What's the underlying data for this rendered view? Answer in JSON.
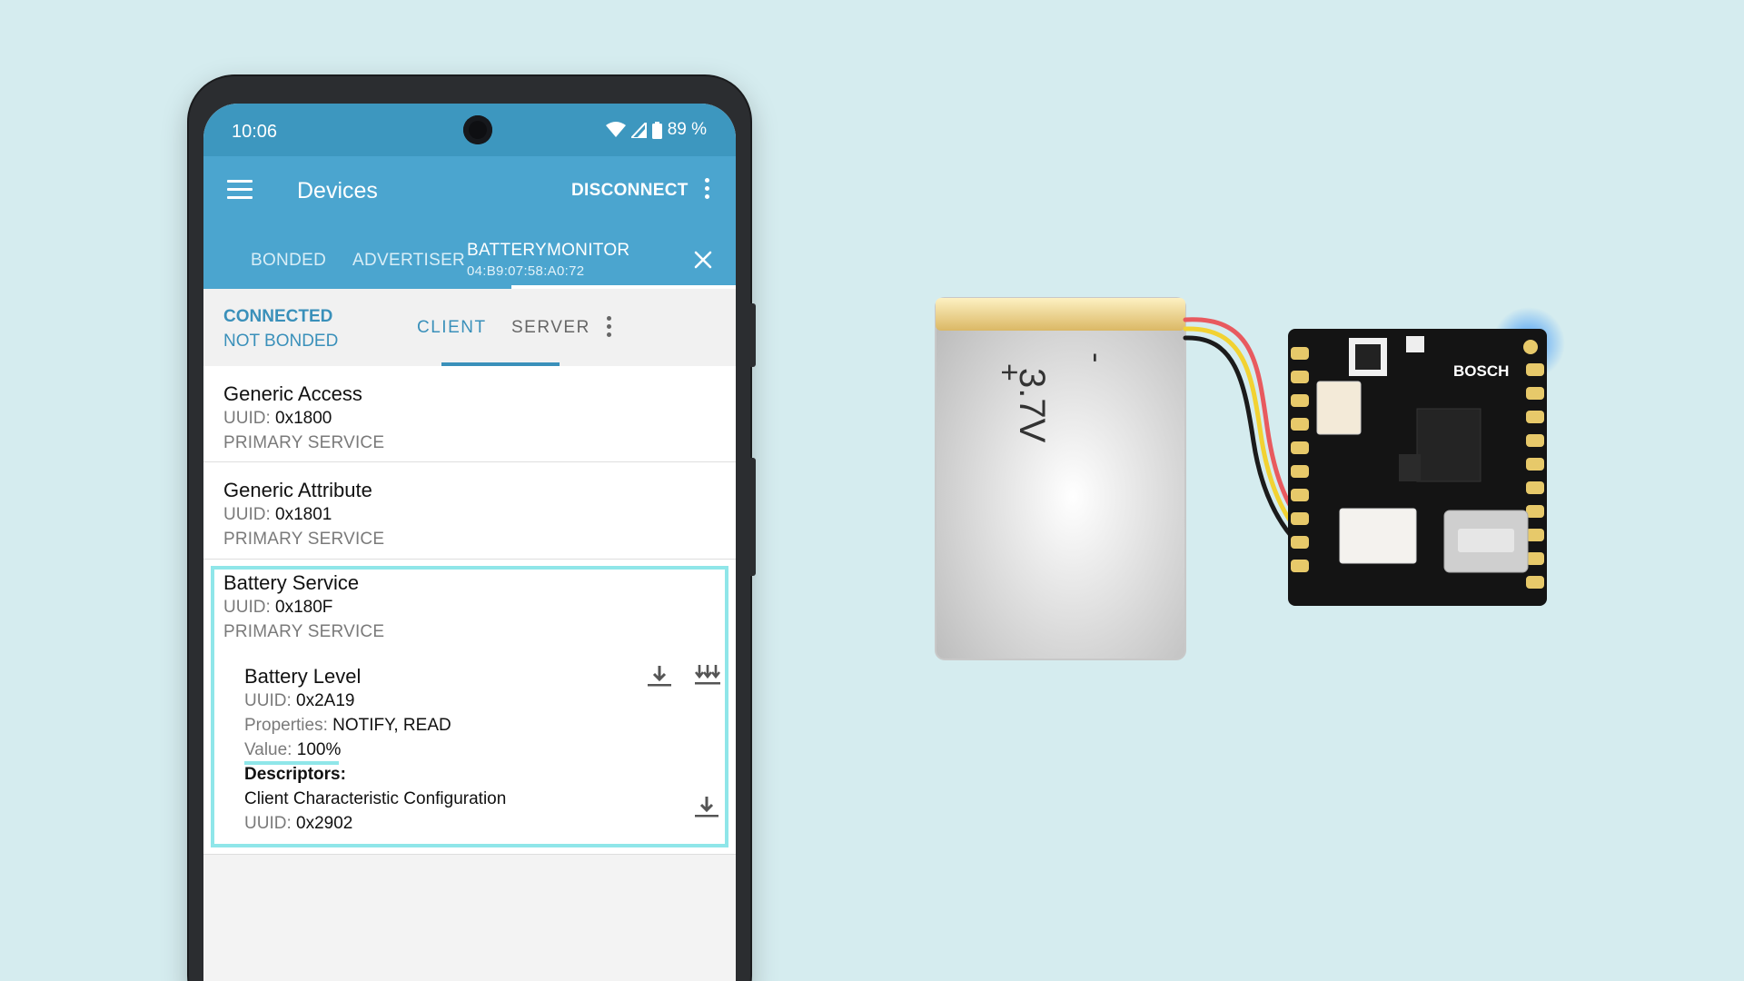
{
  "status_bar": {
    "time": "10:06",
    "battery_percent": "89 %"
  },
  "app_bar": {
    "title": "Devices",
    "disconnect_label": "DISCONNECT"
  },
  "device_tabs": [
    {
      "label": "BONDED"
    },
    {
      "label": "ADVERTISER"
    },
    {
      "label": "BATTERYMONITOR",
      "address": "04:B9:07:58:A0:72",
      "active": true
    }
  ],
  "connection": {
    "state": "CONNECTED",
    "bond": "NOT BONDED"
  },
  "subtabs": [
    {
      "label": "CLIENT",
      "active": true
    },
    {
      "label": "SERVER"
    }
  ],
  "uuid_label": "UUID:",
  "services": [
    {
      "name": "Generic Access",
      "uuid": "0x1800",
      "type": "PRIMARY SERVICE"
    },
    {
      "name": "Generic Attribute",
      "uuid": "0x1801",
      "type": "PRIMARY SERVICE"
    },
    {
      "name": "Battery Service",
      "uuid": "0x180F",
      "type": "PRIMARY SERVICE"
    }
  ],
  "characteristic": {
    "name": "Battery Level",
    "uuid": "0x2A19",
    "properties_label": "Properties:",
    "properties": "NOTIFY, READ",
    "value_label": "Value:",
    "value": "100%",
    "descriptors_label": "Descriptors:",
    "descriptor_name": "Client Characteristic Configuration",
    "descriptor_uuid": "0x2902"
  },
  "hardware": {
    "battery_plus": "+",
    "battery_voltage": "3.7V",
    "battery_minus": "-",
    "board_brand": "BOSCH"
  },
  "colors": {
    "appbar": "#4ba5cf",
    "statusbar": "#3d97bf",
    "accent": "#3a90ba",
    "highlight": "#8fe6e9",
    "background": "#d5ecef"
  }
}
